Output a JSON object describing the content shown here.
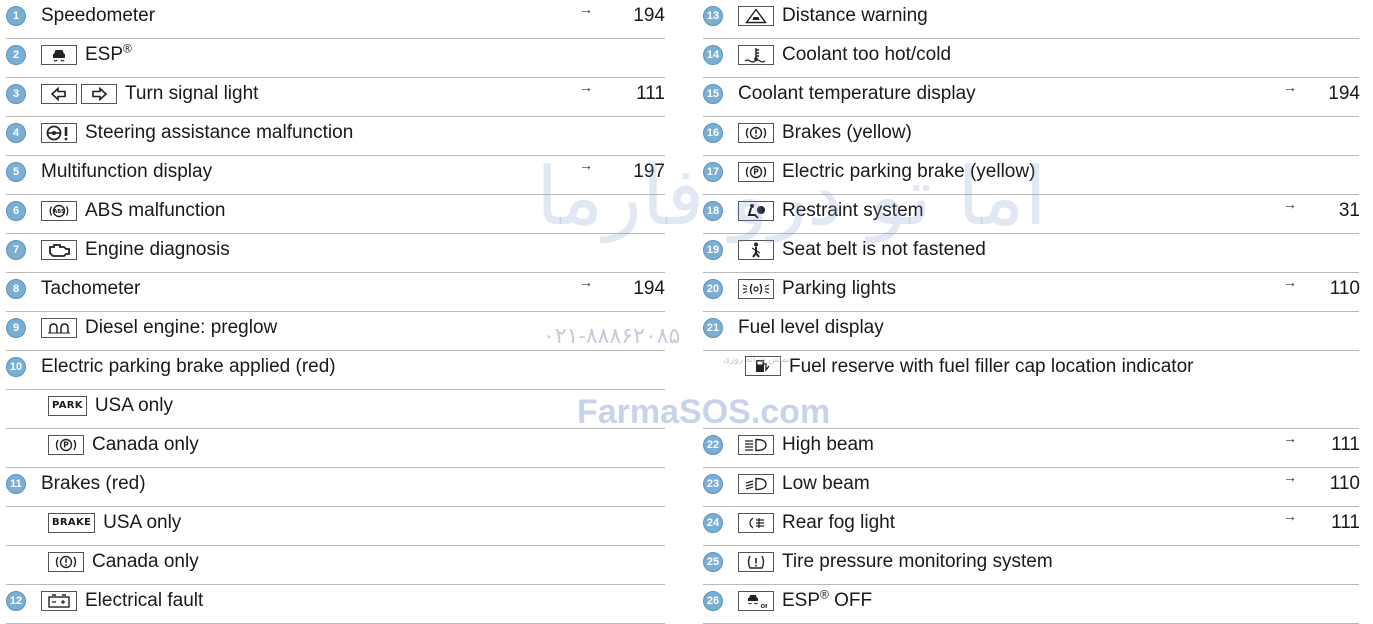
{
  "watermark": {
    "brand_fa": "اما تو درو فارما",
    "phone": "۰۲۱-۸۸۸۶۲۰۸۵",
    "small": "تماس شبانه روزی",
    "site": "FarmaSOS.com"
  },
  "left_column": [
    {
      "num": "1",
      "label": "Speedometer",
      "arrow": "→",
      "page": "194"
    },
    {
      "num": "2",
      "icon": "esp-icon",
      "label": "ESP",
      "sup": "®"
    },
    {
      "num": "3",
      "icon": "turn-left-icon",
      "icon2": "turn-right-icon",
      "label": "Turn signal light",
      "arrow": "→",
      "page": "111"
    },
    {
      "num": "4",
      "icon": "steering-warning-icon",
      "label": "Steering assistance malfunction"
    },
    {
      "num": "5",
      "label": "Multifunction display",
      "arrow": "→",
      "page": "197"
    },
    {
      "num": "6",
      "icon": "abs-icon",
      "label": "ABS malfunction"
    },
    {
      "num": "7",
      "icon": "engine-icon",
      "label": "Engine diagnosis"
    },
    {
      "num": "8",
      "label": "Tachometer",
      "arrow": "→",
      "page": "194"
    },
    {
      "num": "9",
      "icon": "preglow-icon",
      "label": "Diesel engine: preglow"
    },
    {
      "num": "10",
      "label": "Electric parking brake applied (red)"
    },
    {
      "sub": true,
      "icon": "park-text-icon",
      "icon_text": "PARK",
      "label": "USA only"
    },
    {
      "sub": true,
      "icon": "parking-p-icon",
      "label": "Canada only"
    },
    {
      "num": "11",
      "label": "Brakes (red)"
    },
    {
      "sub": true,
      "icon": "brake-text-icon",
      "icon_text": "BRAKE",
      "label": "USA only"
    },
    {
      "sub": true,
      "icon": "brake-warning-icon",
      "label": "Canada only"
    },
    {
      "num": "12",
      "icon": "battery-icon",
      "label": "Electrical fault"
    }
  ],
  "right_column": [
    {
      "num": "13",
      "icon": "distance-warning-icon",
      "label": "Distance warning"
    },
    {
      "num": "14",
      "icon": "coolant-icon",
      "label": "Coolant too hot/cold"
    },
    {
      "num": "15",
      "label": "Coolant temperature display",
      "arrow": "→",
      "page": "194"
    },
    {
      "num": "16",
      "icon": "brake-warning-icon",
      "label": "Brakes (yellow)"
    },
    {
      "num": "17",
      "icon": "parking-p-icon",
      "label": "Electric parking brake (yellow)"
    },
    {
      "num": "18",
      "icon": "airbag-icon",
      "label": "Restraint system",
      "arrow": "→",
      "page": "31"
    },
    {
      "num": "19",
      "icon": "seatbelt-icon",
      "label": "Seat belt is not fastened"
    },
    {
      "num": "20",
      "icon": "parking-lights-icon",
      "label": "Parking lights",
      "arrow": "→",
      "page": "110"
    },
    {
      "num": "21",
      "label": "Fuel level display"
    },
    {
      "sub": true,
      "tall": true,
      "icon": "fuel-icon",
      "label": "Fuel reserve with fuel filler cap location indicator"
    },
    {
      "num": "22",
      "icon": "high-beam-icon",
      "label": "High beam",
      "arrow": "→",
      "page": "111"
    },
    {
      "num": "23",
      "icon": "low-beam-icon",
      "label": "Low beam",
      "arrow": "→",
      "page": "110"
    },
    {
      "num": "24",
      "icon": "rear-fog-icon",
      "label": "Rear fog light",
      "arrow": "→",
      "page": "111"
    },
    {
      "num": "25",
      "icon": "tire-pressure-icon",
      "label": "Tire pressure monitoring system"
    },
    {
      "num": "26",
      "icon": "esp-off-icon",
      "label": "ESP",
      "sup": "®",
      "label_suffix": " OFF"
    }
  ]
}
